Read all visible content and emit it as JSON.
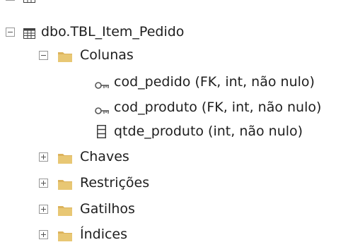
{
  "tree": {
    "table": {
      "label": "dbo.TBL_Item_Pedido",
      "expanded": true,
      "icon": "table-icon"
    },
    "columns_folder": {
      "label": "Colunas",
      "expanded": true,
      "icon": "folder-icon",
      "items": [
        {
          "label": "cod_pedido (FK, int, não nulo)",
          "icon": "key-icon"
        },
        {
          "label": "cod_produto (FK, int, não nulo)",
          "icon": "key-icon"
        },
        {
          "label": "qtde_produto (int, não nulo)",
          "icon": "column-icon"
        }
      ]
    },
    "folders": [
      {
        "label": "Chaves",
        "expanded": false,
        "icon": "folder-icon"
      },
      {
        "label": "Restrições",
        "expanded": false,
        "icon": "folder-icon"
      },
      {
        "label": "Gatilhos",
        "expanded": false,
        "icon": "folder-icon"
      },
      {
        "label": "Índices",
        "expanded": false,
        "icon": "folder-icon"
      }
    ]
  },
  "colors": {
    "folder": "#dcb35c",
    "folder_tab": "#e8c774",
    "table_grid": "#404040",
    "text": "#1e1e1e"
  }
}
